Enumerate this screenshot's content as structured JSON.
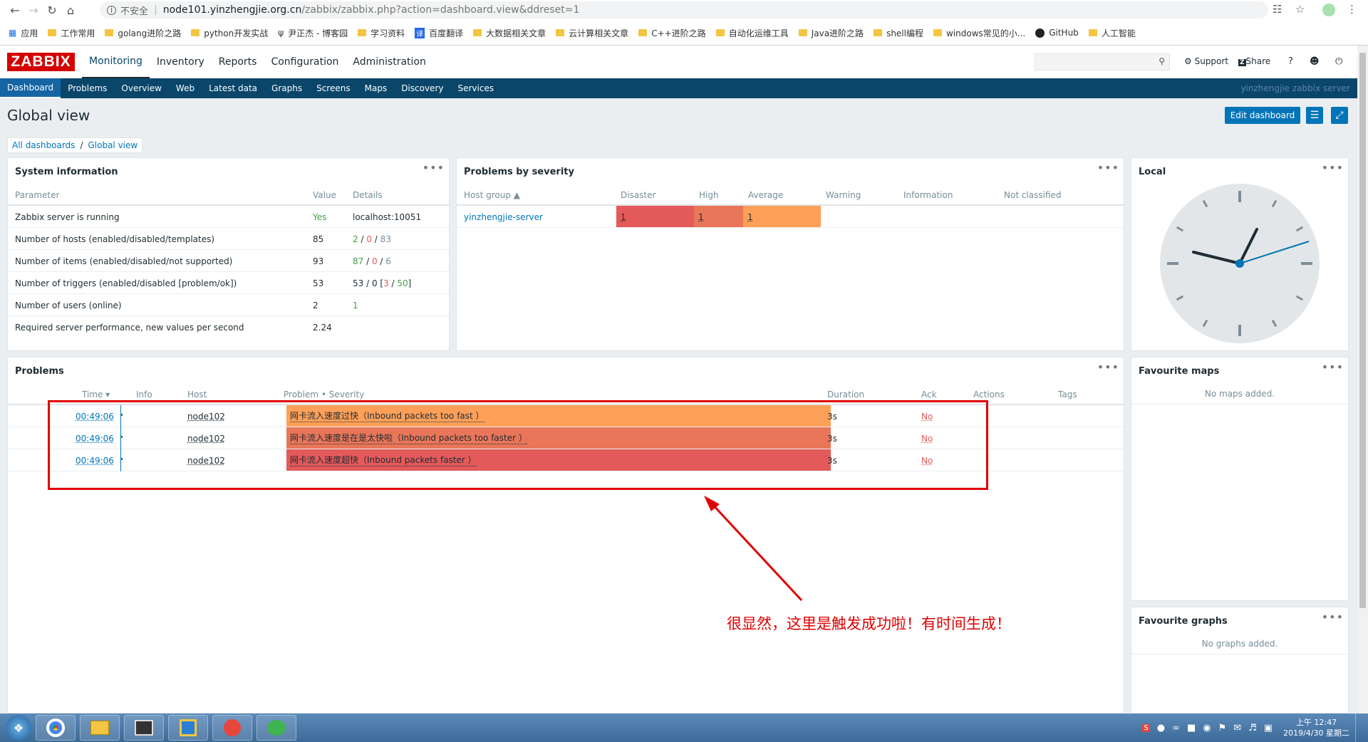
{
  "browser": {
    "insecure_label": "不安全",
    "url_host": "node101.yinzhengjie.org.cn",
    "url_path": "/zabbix/zabbix.php?action=dashboard.view&ddreset=1",
    "bookmarks": [
      "应用",
      "工作常用",
      "golang进阶之路",
      "python开发实战",
      "尹正杰 - 博客园",
      "学习资料",
      "百度翻译",
      "大数据相关文章",
      "云计算相关文章",
      "C++进阶之路",
      "自动化运维工具",
      "Java进阶之路",
      "shell编程",
      "windows常见的小...",
      "GitHub",
      "人工智能"
    ]
  },
  "header": {
    "logo": "ZABBIX",
    "menu": [
      "Monitoring",
      "Inventory",
      "Reports",
      "Configuration",
      "Administration"
    ],
    "support": "Support",
    "share": "Share",
    "help": "?"
  },
  "subnav": {
    "items": [
      "Dashboard",
      "Problems",
      "Overview",
      "Web",
      "Latest data",
      "Graphs",
      "Screens",
      "Maps",
      "Discovery",
      "Services"
    ],
    "server_name": "yinzhengjie zabbix server"
  },
  "page": {
    "title": "Global view",
    "edit_button": "Edit dashboard",
    "breadcrumb": [
      "All dashboards",
      "Global view"
    ]
  },
  "sysinfo": {
    "title": "System information",
    "headers": [
      "Parameter",
      "Value",
      "Details"
    ],
    "rows": [
      {
        "param": "Zabbix server is running",
        "value": "Yes",
        "d1": "localhost:10051",
        "d2": "",
        "d3": "",
        "d4": ""
      },
      {
        "param": "Number of hosts (enabled/disabled/templates)",
        "value": "85",
        "d1": "2",
        "d2": "0",
        "d3": "83",
        "d4": ""
      },
      {
        "param": "Number of items (enabled/disabled/not supported)",
        "value": "93",
        "d1": "87",
        "d2": "0",
        "d3": "6",
        "d4": ""
      },
      {
        "param": "Number of triggers (enabled/disabled [problem/ok])",
        "value": "53",
        "d1": "53 / 0 [",
        "d2": "3",
        "d3": "50",
        "d4": "]"
      },
      {
        "param": "Number of users (online)",
        "value": "2",
        "d1": "1",
        "d2": "",
        "d3": "",
        "d4": ""
      },
      {
        "param": "Required server performance, new values per second",
        "value": "2.24",
        "d1": "",
        "d2": "",
        "d3": "",
        "d4": ""
      }
    ]
  },
  "severity": {
    "title": "Problems by severity",
    "headers": [
      "Host group ▲",
      "Disaster",
      "High",
      "Average",
      "Warning",
      "Information",
      "Not classified"
    ],
    "row": {
      "group": "yinzhengjie-server",
      "disaster": "1",
      "high": "1",
      "average": "1"
    },
    "colors": {
      "disaster": "#e45959",
      "high": "#e97659",
      "average": "#ffa059"
    }
  },
  "local": {
    "title": "Local"
  },
  "problems": {
    "title": "Problems",
    "headers": [
      "Time ▾",
      "Info",
      "Host",
      "Problem • Severity",
      "Duration",
      "Ack",
      "Actions",
      "Tags"
    ],
    "rows": [
      {
        "time": "00:49:06",
        "host": "node102",
        "problem": "网卡流入速度过快（Inbound packets too fast ）",
        "duration": "3s",
        "ack": "No",
        "color": "#ffa059"
      },
      {
        "time": "00:49:06",
        "host": "node102",
        "problem": "网卡流入速度是在是太快啦（Inbound packets too faster ）",
        "duration": "3s",
        "ack": "No",
        "color": "#e97659"
      },
      {
        "time": "00:49:06",
        "host": "node102",
        "problem": "网卡流入速度超快（Inbound packets faster ）",
        "duration": "3s",
        "ack": "No",
        "color": "#e45959"
      }
    ]
  },
  "fav_maps": {
    "title": "Favourite maps",
    "empty": "No maps added."
  },
  "fav_graphs": {
    "title": "Favourite graphs",
    "empty": "No graphs added."
  },
  "annotation": "很显然，这里是触发成功啦！有时间生成！",
  "taskbar": {
    "time": "上午 12:47",
    "date": "2019/4/30 星期二"
  }
}
